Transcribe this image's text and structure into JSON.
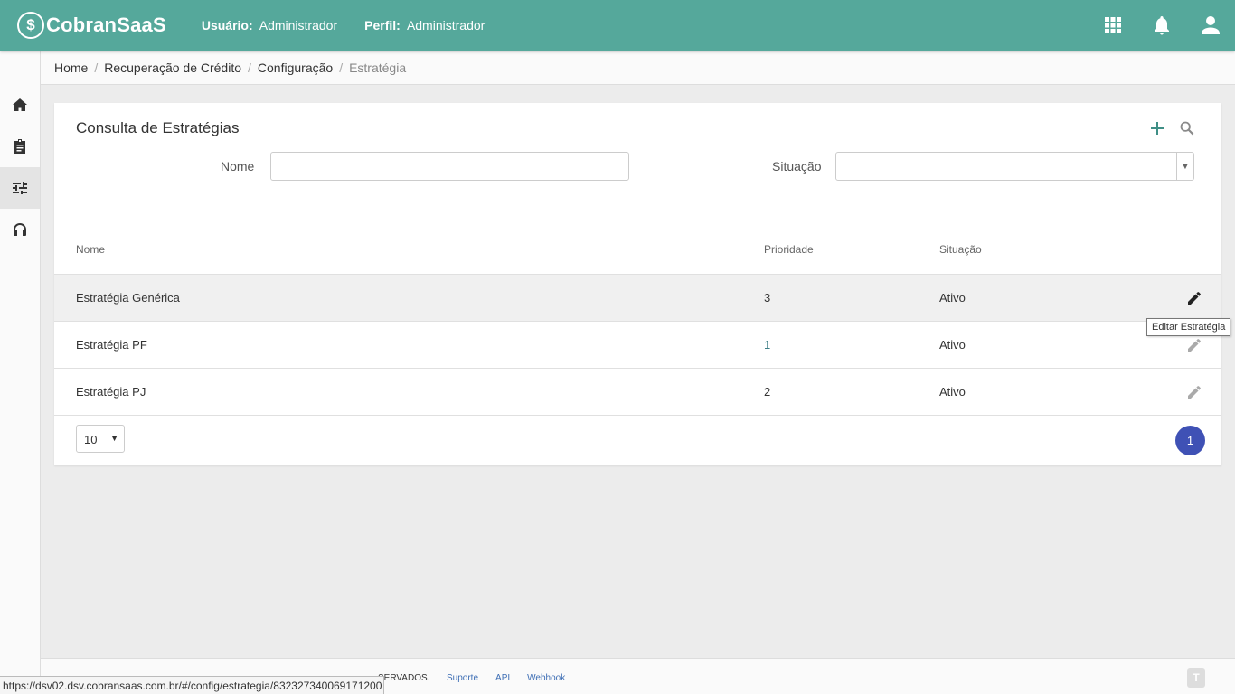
{
  "header": {
    "brand": "CobranSaaS",
    "logo_glyph": "$",
    "user_label": "Usuário:",
    "user_value": "Administrador",
    "profile_label": "Perfil:",
    "profile_value": "Administrador",
    "icons": [
      "apps-grid-icon",
      "bell-icon",
      "user-account-icon"
    ]
  },
  "sidebar": {
    "items": [
      {
        "icon": "home-icon",
        "active": false
      },
      {
        "icon": "clipboard-icon",
        "active": false
      },
      {
        "icon": "sliders-icon",
        "active": true
      },
      {
        "icon": "headset-icon",
        "active": false
      }
    ]
  },
  "breadcrumb": {
    "items": [
      "Home",
      "Recuperação de Crédito",
      "Configuração"
    ],
    "current": "Estratégia"
  },
  "card": {
    "title": "Consulta de Estratégias",
    "actions": [
      "add-icon",
      "search-icon"
    ]
  },
  "filters": {
    "nome_label": "Nome",
    "nome_value": "",
    "situacao_label": "Situação",
    "situacao_value": ""
  },
  "table": {
    "columns": [
      "Nome",
      "Prioridade",
      "Situação"
    ],
    "rows": [
      {
        "nome": "Estratégia Genérica",
        "prioridade": "3",
        "situacao": "Ativo"
      },
      {
        "nome": "Estratégia PF",
        "prioridade": "1",
        "situacao": "Ativo"
      },
      {
        "nome": "Estratégia PJ",
        "prioridade": "2",
        "situacao": "Ativo"
      }
    ],
    "edit_tooltip": "Editar Estratégia"
  },
  "pagination": {
    "page_size": "10",
    "current_page": "1"
  },
  "footer": {
    "copyright_fragment": "SERVADOS.",
    "links": [
      "Suporte",
      "API",
      "Webhook"
    ]
  },
  "status_bar": {
    "url": "https://dsv02.dsv.cobransaas.com.br/#/config/estrategia/832327340069171200"
  },
  "colors": {
    "header_bg": "#55a89b",
    "accent": "#3f51b5",
    "link": "#3f7f88"
  }
}
